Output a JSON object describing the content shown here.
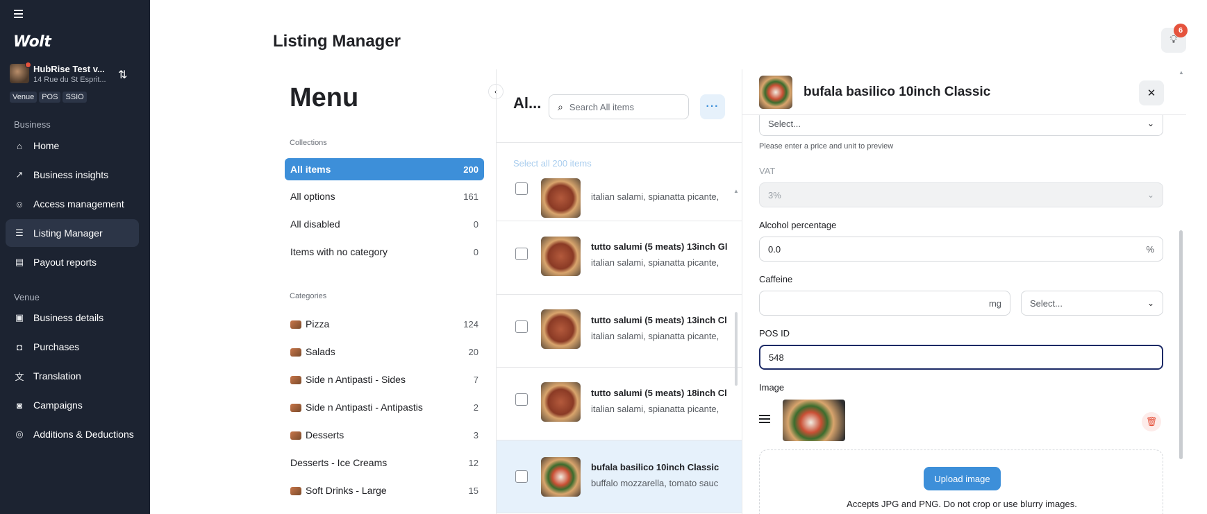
{
  "sidebar": {
    "logo": "Wolt",
    "venue": {
      "name": "HubRise Test v...",
      "address": "14 Rue du St Esprit..."
    },
    "badges": [
      "Venue",
      "POS",
      "SSIO"
    ],
    "sections": {
      "business": "Business",
      "venue": "Venue"
    },
    "business_items": [
      {
        "label": "Home",
        "icon": "home-icon"
      },
      {
        "label": "Business insights",
        "icon": "chart-icon"
      },
      {
        "label": "Access management",
        "icon": "users-icon"
      },
      {
        "label": "Listing Manager",
        "icon": "list-icon"
      },
      {
        "label": "Payout reports",
        "icon": "receipt-icon"
      }
    ],
    "venue_items": [
      {
        "label": "Business details",
        "icon": "briefcase-icon"
      },
      {
        "label": "Purchases",
        "icon": "bag-icon"
      },
      {
        "label": "Translation",
        "icon": "translate-icon"
      },
      {
        "label": "Campaigns",
        "icon": "campaign-icon"
      },
      {
        "label": "Additions & Deductions",
        "icon": "coins-icon"
      }
    ]
  },
  "header": {
    "title": "Listing Manager",
    "notifications_count": "6"
  },
  "menu": {
    "heading": "Menu",
    "collections_label": "Collections",
    "collections": [
      {
        "label": "All items",
        "count": "200"
      },
      {
        "label": "All options",
        "count": "161"
      },
      {
        "label": "All disabled",
        "count": "0"
      },
      {
        "label": "Items with no category",
        "count": "0"
      }
    ],
    "categories_label": "Categories",
    "categories": [
      {
        "label": "Pizza",
        "count": "124"
      },
      {
        "label": "Salads",
        "count": "20"
      },
      {
        "label": "Side n Antipasti - Sides",
        "count": "7"
      },
      {
        "label": "Side n Antipasti - Antipastis",
        "count": "2"
      },
      {
        "label": "Desserts",
        "count": "3"
      },
      {
        "label": "Desserts - Ice Creams",
        "count": "12"
      },
      {
        "label": "Soft Drinks - Large",
        "count": "15"
      }
    ]
  },
  "items": {
    "title": "Al...",
    "search_placeholder": "Search All items",
    "select_all": "Select all 200 items",
    "rows": [
      {
        "name": "",
        "desc": "italian salami, spianatta picante,"
      },
      {
        "name": "tutto salumi (5 meats) 13inch Gl",
        "desc": "italian salami, spianatta picante,"
      },
      {
        "name": "tutto salumi (5 meats) 13inch Cl",
        "desc": "italian salami, spianatta picante,"
      },
      {
        "name": "tutto salumi (5 meats) 18inch Cl",
        "desc": "italian salami, spianatta picante,"
      },
      {
        "name": "bufala basilico 10inch Classic",
        "desc": "buffalo mozzarella, tomato sauc"
      }
    ]
  },
  "detail": {
    "title": "bufala basilico 10inch Classic",
    "unit_select": "Select...",
    "price_hint": "Please enter a price and unit to preview",
    "vat_label": "VAT",
    "vat_value": "3%",
    "alcohol_label": "Alcohol percentage",
    "alcohol_value": "0.0",
    "alcohol_unit": "%",
    "caffeine_label": "Caffeine",
    "caffeine_unit": "mg",
    "caffeine_select": "Select...",
    "pos_label": "POS ID",
    "pos_value": "548",
    "image_label": "Image",
    "upload_label": "Upload image",
    "accepts_text": "Accepts JPG and PNG. Do not crop or use blurry images."
  }
}
